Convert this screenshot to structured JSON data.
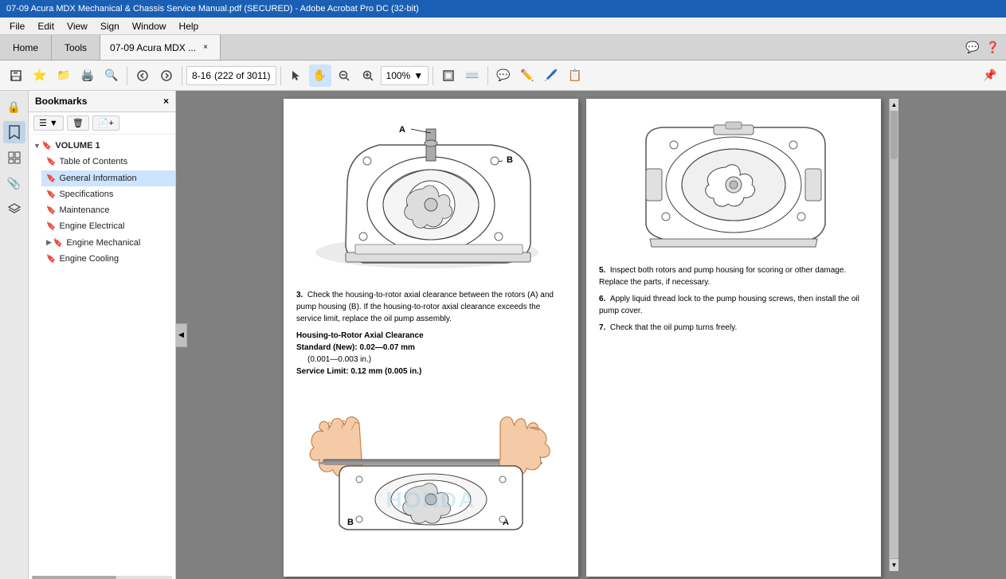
{
  "titleBar": {
    "text": "07-09 Acura MDX Mechanical & Chassis Service Manual.pdf (SECURED) - Adobe Acrobat Pro DC (32-bit)"
  },
  "menuBar": {
    "items": [
      "File",
      "Edit",
      "View",
      "Sign",
      "Window",
      "Help"
    ]
  },
  "tabs": {
    "home": "Home",
    "tools": "Tools",
    "doc": "07-09 Acura MDX ...",
    "close": "×"
  },
  "toolbar": {
    "pageInfo": "8-16",
    "pageOf": "(222 of 3011)",
    "zoom": "100%"
  },
  "bookmarks": {
    "title": "Bookmarks",
    "close": "×",
    "items": [
      {
        "label": "VOLUME 1",
        "indent": 0,
        "expanded": true,
        "arrow": "▼"
      },
      {
        "label": "Table of Contents",
        "indent": 1
      },
      {
        "label": "General Information",
        "indent": 1,
        "selected": true
      },
      {
        "label": "Specifications",
        "indent": 1
      },
      {
        "label": "Maintenance",
        "indent": 1
      },
      {
        "label": "Engine Electrical",
        "indent": 1
      },
      {
        "label": "Engine Mechanical",
        "indent": 1,
        "hasArrow": true
      },
      {
        "label": "Engine Cooling",
        "indent": 1
      }
    ]
  },
  "pdfContent": {
    "leftPage": {
      "step3": {
        "number": "3.",
        "text": "Check the housing-to-rotor axial clearance between the rotors (A) and pump housing (B). If the housing-to-rotor axial clearance exceeds the service limit, replace the oil pump assembly."
      },
      "spec": {
        "title": "Housing-to-Rotor Axial Clearance",
        "standard": "Standard (New): 0.02—0.07 mm",
        "standardIn": "(0.001—0.003 in.)",
        "serviceLimit": "Service Limit:    0.12 mm (0.005 in.)"
      },
      "labelA": "A",
      "labelB": "B"
    },
    "rightPage": {
      "step5": {
        "number": "5.",
        "text": "Inspect both rotors and pump housing for scoring or other damage. Replace the parts, if necessary."
      },
      "step6": {
        "number": "6.",
        "text": "Apply liquid thread lock to the pump housing screws, then install the oil pump cover."
      },
      "step7": {
        "number": "7.",
        "text": "Check that the oil pump turns freely."
      }
    }
  },
  "sidebarIcons": [
    {
      "name": "lock-icon",
      "symbol": "🔒"
    },
    {
      "name": "grid-icon",
      "symbol": "⊞"
    },
    {
      "name": "layers-icon",
      "symbol": "⧉"
    },
    {
      "name": "bookmark-icon",
      "symbol": "🔖",
      "active": true
    },
    {
      "name": "link-icon",
      "symbol": "📎"
    },
    {
      "name": "layers2-icon",
      "symbol": "◫"
    }
  ]
}
